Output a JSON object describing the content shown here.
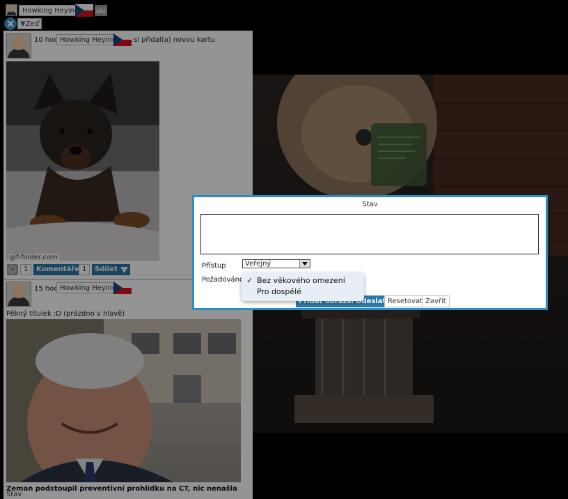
{
  "top_bar": {
    "user_name": "Howking Heying",
    "wall_label": "Zeď"
  },
  "posts": [
    {
      "time": "10 hod",
      "author": "Howking Heying",
      "action": "si přidal(a) novou kartu",
      "watermark": "gif-finder.com",
      "like_count": "1",
      "comments_label": "Komentáře",
      "comment_count": "1",
      "share_label": "Sdílet"
    },
    {
      "time": "15 hod",
      "author": "Howking Heying",
      "text": "Pěkný titulek :D (prázdno v hlavě)",
      "caption": "Zeman podstoupil preventivní prohlídku na CT, nic nenašla"
    }
  ],
  "bottom_tab": "Stav",
  "dialog": {
    "title": "Stav",
    "textarea_value": "",
    "access_label": "Přístup",
    "access_value": "Veřejný",
    "required_label": "Požadováno",
    "buttons": {
      "add_picture": "Přidat obrázek",
      "send": "Odeslat",
      "reset": "Resetovat",
      "close": "Zavřít"
    },
    "dropdown": {
      "options": [
        "Bez věkového omezení",
        "Pro dospělé"
      ],
      "selected_index": 0
    }
  }
}
